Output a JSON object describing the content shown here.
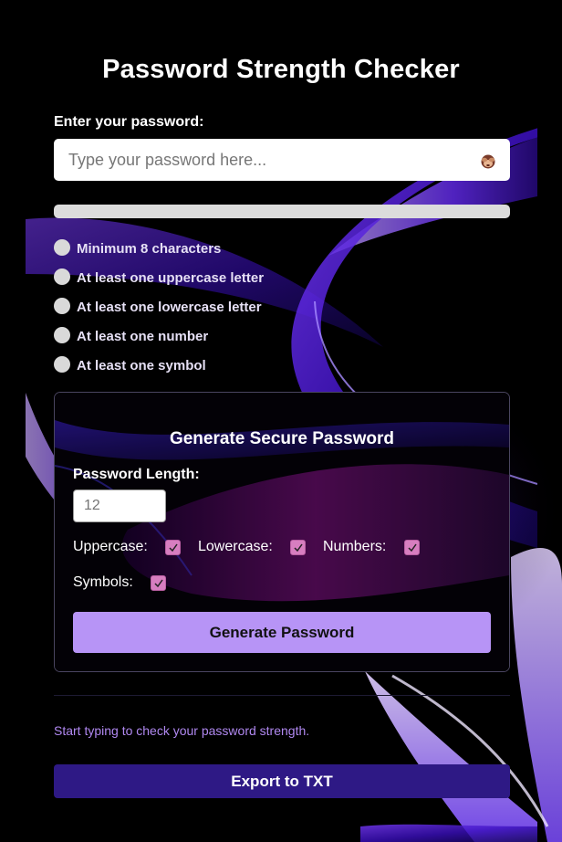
{
  "app": {
    "title": "Password Strength Checker"
  },
  "password": {
    "label": "Enter your password:",
    "placeholder": "Type your password here...",
    "value": "",
    "toggle_icon": "see-no-evil-monkey-icon",
    "strength_fraction": 0
  },
  "requirements": [
    {
      "label": "Minimum 8 characters",
      "met": false
    },
    {
      "label": "At least one uppercase letter",
      "met": false
    },
    {
      "label": "At least one lowercase letter",
      "met": false
    },
    {
      "label": "At least one number",
      "met": false
    },
    {
      "label": "At least one symbol",
      "met": false
    }
  ],
  "generator": {
    "title": "Generate Secure Password",
    "length_label": "Password Length:",
    "length_placeholder": "12",
    "options": {
      "uppercase": {
        "label": "Uppercase:",
        "checked": true
      },
      "lowercase": {
        "label": "Lowercase:",
        "checked": true
      },
      "numbers": {
        "label": "Numbers:",
        "checked": true
      },
      "symbols": {
        "label": "Symbols:",
        "checked": true
      }
    },
    "button_label": "Generate Password"
  },
  "status_text": "Start typing to check your password strength.",
  "export_label": "Export to TXT",
  "colors": {
    "accent": "#b794f6",
    "export_button": "#2e1985",
    "status_text": "#b088f0",
    "checkbox": "#d77ec0",
    "requirement_dot": "#d9d9d9",
    "strength_track": "#dcdcdc"
  }
}
